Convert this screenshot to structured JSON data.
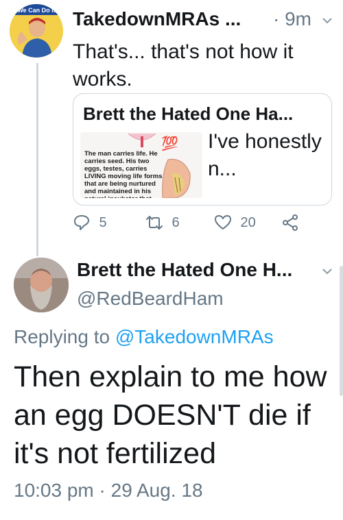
{
  "tweet1": {
    "avatar_text": "We Can Do It",
    "author": "TakedownMRAs ...",
    "time": "· 9m",
    "text": "That's... that's not how it works.",
    "quote": {
      "author": "Brett the Hated One Ha...",
      "image_text": "The man carries life. He carries seed. His two eggs, testes, carries LIVING moving life forms that are being nurtured and maintained in his natural incubator that",
      "image_emoji": "💯",
      "text": "I've honestly n..."
    },
    "replies": "5",
    "retweets": "6",
    "likes": "20"
  },
  "tweet2": {
    "author": "Brett the Hated One H...",
    "handle": "@RedBeardHam",
    "replying_prefix": "Replying to",
    "replying_to": "@TakedownMRAs",
    "text": "Then explain to me how an egg DOESN'T die if it's not fertilized",
    "timestamp": "10:03 pm · 29 Aug. 18"
  },
  "colors": {
    "accent": "#1da1f2",
    "muted": "#657786",
    "text": "#14171a",
    "border": "#ccd6dd"
  },
  "icons": [
    "reply-icon",
    "retweet-icon",
    "like-icon",
    "share-icon",
    "chevron-down-icon"
  ]
}
